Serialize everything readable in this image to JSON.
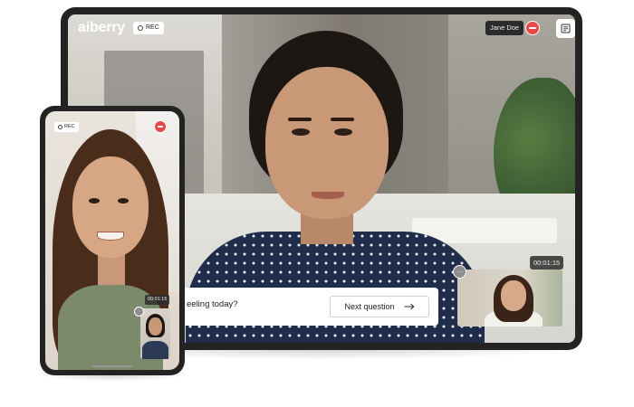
{
  "tablet": {
    "logo": "aiberry",
    "rec_label": "REC",
    "participant_name": "Jane Doe",
    "question_text": "eeling today?",
    "next_button_label": "Next question",
    "timer": "00:01:15",
    "icons": {
      "end_call": "end-call-icon",
      "notes": "notes-icon",
      "arrow": "arrow-right-icon",
      "options": "more-options-icon"
    }
  },
  "phone": {
    "rec_label": "REC",
    "timer": "00:01:15"
  },
  "colors": {
    "end_call": "#e84a4a",
    "device_frame": "#232323"
  }
}
